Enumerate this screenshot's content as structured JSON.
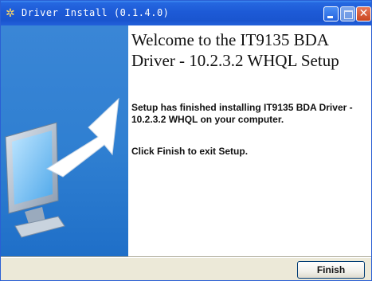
{
  "window": {
    "title": "Driver Install (0.1.4.0)",
    "app_icon": "setup-app-icon",
    "accent_color": "#1d5ad6",
    "controls": {
      "minimize_icon": "minimize-icon",
      "maximize_icon": "maximize-icon",
      "close_icon": "close-icon",
      "close_glyph": "✕"
    }
  },
  "side_panel": {
    "image": "monitor-with-arrow-icon",
    "background_color": "#2f7fd1"
  },
  "content": {
    "title": "Welcome to the IT9135 BDA Driver - 10.2.3.2 WHQL Setup",
    "installed_message": "Setup has finished installing IT9135 BDA Driver - 10.2.3.2 WHQL on your computer.",
    "finish_instruction": "Click Finish to exit Setup."
  },
  "buttons": {
    "finish_label": "Finish"
  }
}
